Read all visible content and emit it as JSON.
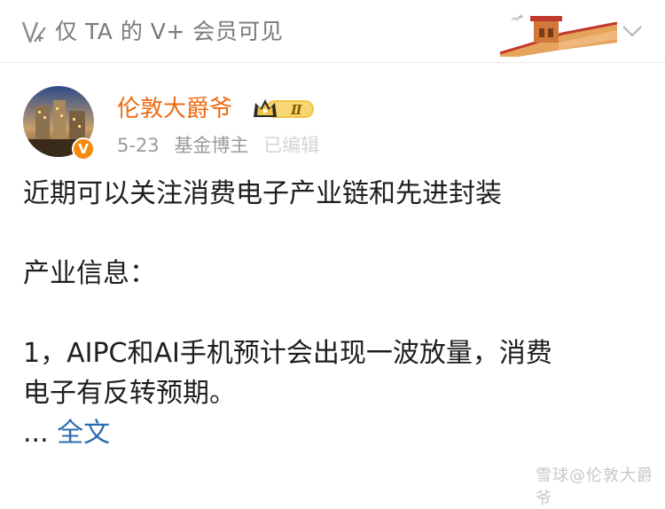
{
  "visibility": {
    "text": "仅 TA 的 V+ 会员可见",
    "icon": "v-plus-lock-icon"
  },
  "author": {
    "name": "伦敦大爵爷",
    "badge_level": "Ⅱ",
    "verified_mark": "V",
    "date": "5-23",
    "role": "基金博主",
    "edited": "已编辑",
    "colors": {
      "name": "#ee6a11",
      "verified": "#f68a0f"
    }
  },
  "post": {
    "line1": "近期可以关注消费电子产业链和先进封装",
    "line2": "产业信息：",
    "line3": "1，AIPC和AI手机预计会出现一波放量，消费",
    "line4": "电子有反转预期。",
    "ellipsis": "...",
    "more_label": "全文"
  },
  "watermark": "雪球@伦敦大爵爷"
}
